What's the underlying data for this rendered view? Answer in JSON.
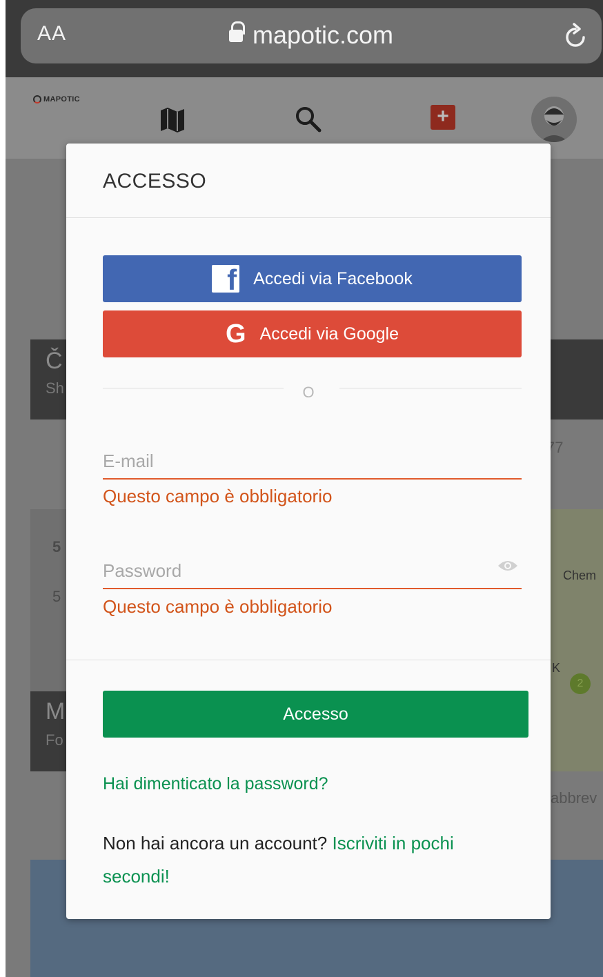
{
  "browser": {
    "text_size_label": "AA",
    "url": "mapotic.com"
  },
  "app": {
    "logo_text": "MAPOTIC"
  },
  "background": {
    "card1_title_partial": "Č",
    "card1_sub_partial": "Sh",
    "card1_count_partial": "77",
    "card2_num1": "5",
    "card2_num2": "5",
    "map_label": "Chem",
    "map_label2": "K",
    "map_badge": "2",
    "card3_title_partial": "M",
    "card3_sub_partial": "Fo",
    "card3_text_partial": "abbrev"
  },
  "modal": {
    "title": "ACCESSO",
    "facebook_label": "Accedi via Facebook",
    "google_label": "Accedi via Google",
    "or_label": "O",
    "email": {
      "placeholder": "E-mail",
      "value": "",
      "error": "Questo campo è obbligatorio"
    },
    "password": {
      "placeholder": "Password",
      "value": "",
      "error": "Questo campo è obbligatorio"
    },
    "submit_label": "Accesso",
    "forgot_label": "Hai dimenticato la password?",
    "signup_prompt": "Non hai ancora un account?",
    "signup_link": "Iscriviti in pochi secondi!"
  },
  "colors": {
    "facebook": "#4267b2",
    "google": "#dd4b39",
    "primary_green": "#0a9150",
    "error": "#d2541a"
  }
}
